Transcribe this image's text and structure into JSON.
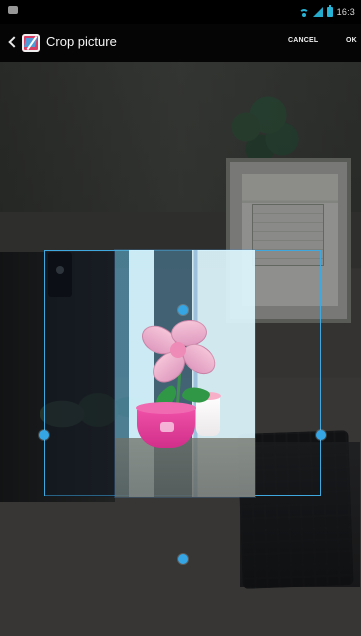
{
  "status_bar": {
    "time": "16:3"
  },
  "app_bar": {
    "title": "Crop picture",
    "cancel_label": "CANCEL",
    "ok_label": "OK"
  },
  "icons": {
    "back": "chevron-left-icon",
    "app": "picture-icon",
    "wifi": "wifi-icon",
    "signal": "signal-icon",
    "battery": "battery-icon"
  },
  "crop_editor": {
    "handles": [
      "top",
      "right",
      "bottom",
      "left"
    ],
    "accent_color": "#3ea8df"
  }
}
